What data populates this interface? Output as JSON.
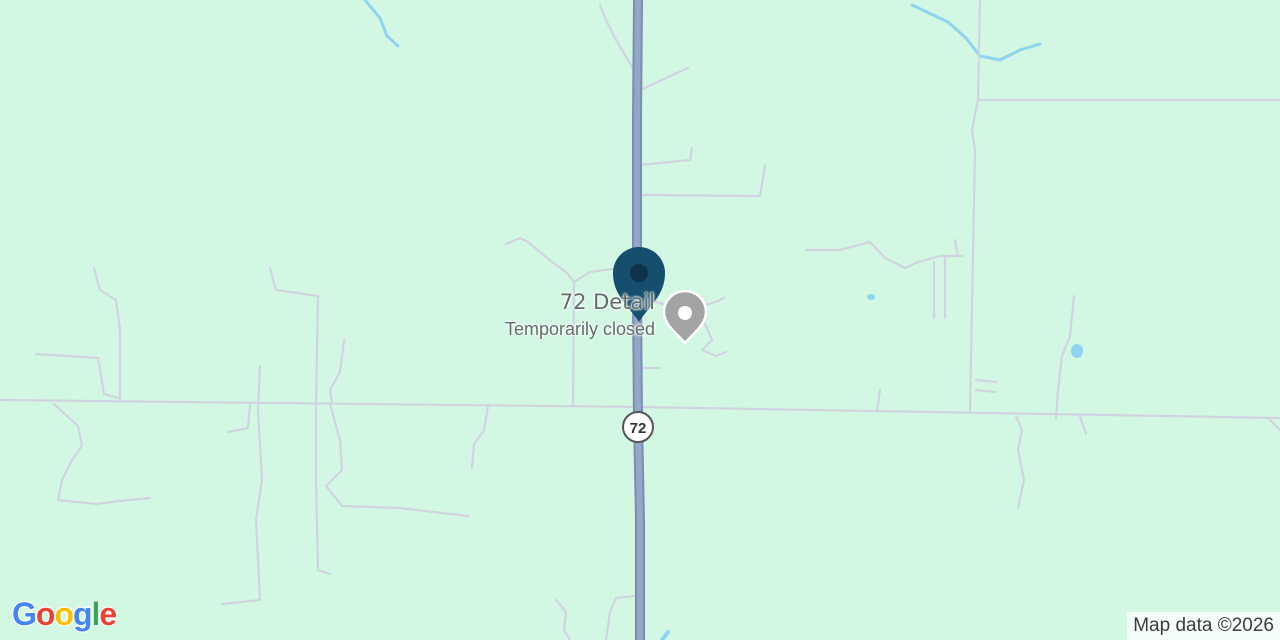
{
  "map": {
    "background_color": "#d2f8e3",
    "road_color": "#d0d4e0",
    "highway_color": "#8fa1c2",
    "water_color": "#8ed3f0"
  },
  "highway_shield": {
    "label": "72"
  },
  "poi": {
    "name": "72 Detail",
    "status": "Temporarily closed",
    "icon": "place-pin-icon"
  },
  "marker": {
    "icon": "map-marker-icon",
    "color": "#164f6e"
  },
  "logo": {
    "text": "Google",
    "letters": [
      "G",
      "o",
      "o",
      "g",
      "l",
      "e"
    ],
    "colors": [
      "#4285F4",
      "#EA4335",
      "#FBBC05",
      "#4285F4",
      "#34A853",
      "#EA4335"
    ]
  },
  "attribution": {
    "text": "Map data ©2026"
  }
}
